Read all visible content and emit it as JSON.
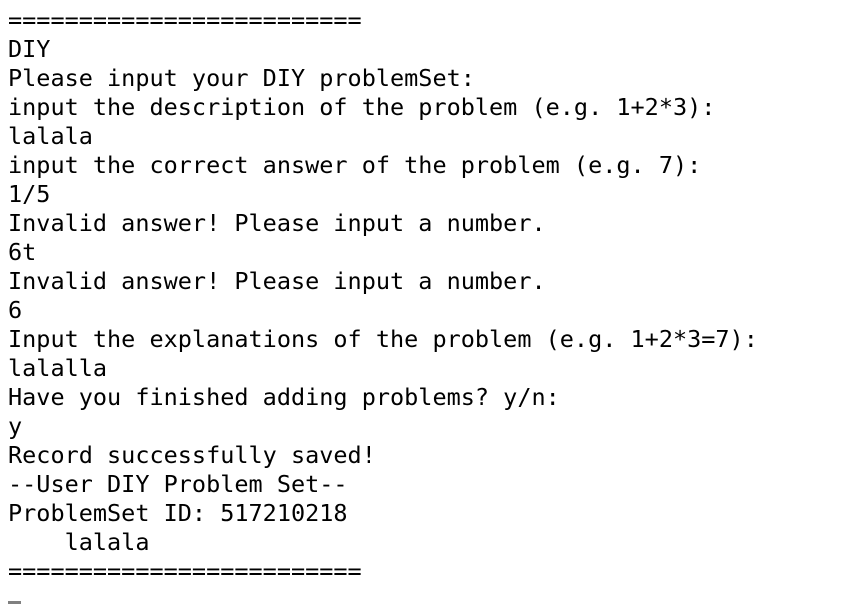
{
  "terminal": {
    "background_color": "#ffffff",
    "text_color": "#000000",
    "cursor_color": "#808080",
    "lines": [
      "=========================",
      "DIY",
      "Please input your DIY problemSet:",
      "input the description of the problem (e.g. 1+2*3):",
      "lalala",
      "input the correct answer of the problem (e.g. 7):",
      "1/5",
      "Invalid answer! Please input a number.",
      "6t",
      "Invalid answer! Please input a number.",
      "6",
      "Input the explanations of the problem (e.g. 1+2*3=7):",
      "lalalla",
      "Have you finished adding problems? y/n:",
      "y",
      "Record successfully saved!",
      "--User DIY Problem Set--",
      "ProblemSet ID: 517210218",
      "    lalala",
      "========================="
    ],
    "prompt_separator": "=========================",
    "program_name": "DIY",
    "prompts": {
      "problem_set": "Please input your DIY problemSet:",
      "description": "input the description of the problem (e.g. 1+2*3):",
      "correct_answer": "input the correct answer of the problem (e.g. 7):",
      "explanations": "Input the explanations of the problem (e.g. 1+2*3=7):",
      "finished": "Have you finished adding problems? y/n:"
    },
    "user_inputs": {
      "description_value": "lalala",
      "answer_attempt_1": "1/5",
      "answer_attempt_2": "6t",
      "answer_accepted": "6",
      "explanation_value": "lalalla",
      "finished_value": "y"
    },
    "errors": {
      "invalid_answer": "Invalid answer! Please input a number."
    },
    "results": {
      "saved_message": "Record successfully saved!",
      "set_header": "--User DIY Problem Set--",
      "problem_set_id_line": "ProblemSet ID: 517210218",
      "problem_set_id": "517210218",
      "problem_item": "lalala"
    },
    "cursor_glyph": "_"
  }
}
